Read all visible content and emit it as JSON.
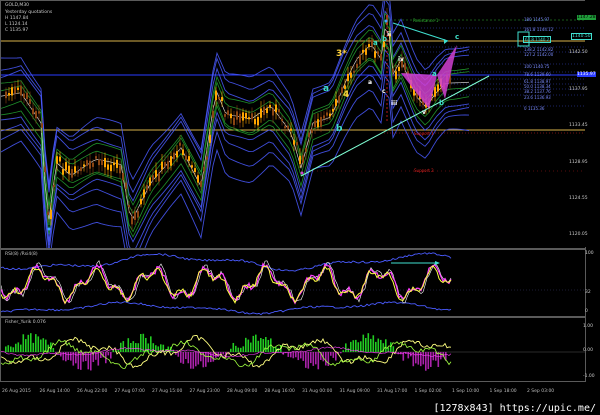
{
  "chart": {
    "title": "GOLD,M30",
    "info": {
      "line1": "Yesterday quotations",
      "line2": "H 1147.84",
      "line3": "L 1124.14",
      "line4": "C 1135.97"
    }
  },
  "waves": {
    "a1": "a",
    "four": "4",
    "three_star": "3*",
    "b1": "b",
    "ii": "ii",
    "iv": "iv",
    "a2": "a",
    "c1": "c",
    "iii": "iii",
    "v": "v",
    "b2": "b",
    "c2": "c",
    "top_a": "a",
    "top_b": "b",
    "c3": "c",
    "a3": "a",
    "b3": "b"
  },
  "levels": {
    "resistance1": "Resistance 1",
    "support1": "Support 1",
    "support2": "Support 2",
    "fib1": "180 1145.97",
    "fib2": "161.8 1144.12",
    "fib3": "138.2 1142.82",
    "fib4": "127.2 1142.00",
    "fib5": "100 1140.75",
    "fib6": "78.6 1139.60",
    "fib7": "61.8 1138.97",
    "fib8": "50.0 1138.34",
    "fib9": "38.2 1137.76",
    "fib10": "23.6 1136.93",
    "fib11": "0 1135.36",
    "fib_box": "61.8 1140.2"
  },
  "price_axis": {
    "ticks": [
      "1147.94",
      "1142.50",
      "1137.95",
      "1133.45",
      "1128.95",
      "1124.55",
      "1120.05",
      "1115.55"
    ],
    "badge_top": "1147.28",
    "badge_mid": "1140.50",
    "badge_blue": "1135.97"
  },
  "rsi": {
    "title": "RSI(8) /Rsi4(8)",
    "tick_top": "100",
    "tick_mid": "50",
    "tick_low": "32",
    "tick_bottom": "0"
  },
  "fisher": {
    "title": "Fisher_Yurik 0.076",
    "tick_top": "1.00",
    "tick_mid": "0.00",
    "tick_bottom": "-1.00"
  },
  "time_axis": [
    "26 Aug 2015",
    "26 Aug 14:00",
    "26 Aug 22:00",
    "27 Aug 07:00",
    "27 Aug 15:00",
    "27 Aug 23:00",
    "28 Aug 09:00",
    "28 Aug 16:00",
    "31 Aug 00:00",
    "31 Aug 09:00",
    "31 Aug 17:00",
    "1 Sep 02:00",
    "1 Sep 10:00",
    "1 Sep 18:00",
    "2 Sep 03:00"
  ],
  "watermark": "[1278x843] https://upic.me/",
  "colors": {
    "bull_candle": "#ffa500",
    "bear_candle": "#8b4513",
    "ma_blue": "#4a5bff",
    "ma_green": "#1f8f2a",
    "gold_line": "#d9b24a",
    "cyan": "#40e0d0",
    "magenta": "#d040d0",
    "red": "#e02020",
    "yellow": "#ffff40"
  }
}
